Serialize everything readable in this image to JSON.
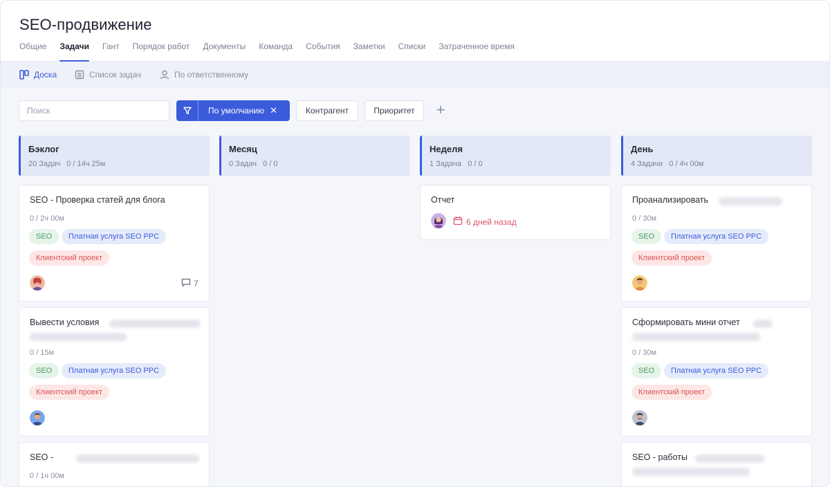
{
  "page_title": "SEO-продвижение",
  "tabs": [
    "Общие",
    "Задачи",
    "Гант",
    "Порядок работ",
    "Документы",
    "Команда",
    "События",
    "Заметки",
    "Списки",
    "Затраченное время"
  ],
  "active_tab": "Задачи",
  "views": {
    "board": "Доска",
    "list": "Список задач",
    "by_assignee": "По ответственному"
  },
  "toolbar": {
    "search_placeholder": "Поиск",
    "filter_label": "По умолчанию",
    "filter_clear": "✕",
    "counterparty": "Контрагент",
    "priority": "Приоритет",
    "add": "+"
  },
  "columns": [
    {
      "title": "Бэклог",
      "stats": "20 Задач   0 / 14ч 25м",
      "cards": [
        {
          "title": "SEO - Проверка статей для блога",
          "time": "0 / 2ч 00м",
          "tags": [
            "SEO",
            "Платная услуга SEO PPC",
            "Клиентский проект"
          ],
          "comments": "7"
        },
        {
          "title": "Вывести условия",
          "time": "0 / 15м",
          "tags": [
            "SEO",
            "Платная услуга SEO PPC",
            "Клиентский проект"
          ]
        },
        {
          "title": "SEO -",
          "time": "0 / 1ч 00м"
        }
      ]
    },
    {
      "title": "Месяц",
      "stats": "0 Задач   0 / 0",
      "cards": []
    },
    {
      "title": "Неделя",
      "stats": "1 Задача   0 / 0",
      "cards": [
        {
          "title": "Отчет",
          "due": "6 дней назад"
        }
      ]
    },
    {
      "title": "День",
      "stats": "4 Задачи   0 / 4ч 00м",
      "cards": [
        {
          "title": "Проанализировать",
          "time": "0 / 30м",
          "tags": [
            "SEO",
            "Платная услуга SEO PPC",
            "Клиентский проект"
          ]
        },
        {
          "title": "Сформировать мини отчет",
          "time": "0 / 30м",
          "tags": [
            "SEO",
            "Платная услуга SEO PPC",
            "Клиентский проект"
          ]
        },
        {
          "title": "SEO - работы"
        }
      ]
    }
  ],
  "colors": {
    "accent": "#3b5bdb",
    "column_header_bg": "#e3e8f7",
    "tag_seo": "#4a9b5e",
    "tag_paid": "#3b5bdb",
    "tag_client": "#d9534f",
    "overdue": "#e0566b"
  },
  "icons": [
    "board-icon",
    "list-icon",
    "person-icon",
    "filter-icon",
    "comment-icon",
    "calendar-icon",
    "plus-icon",
    "close-icon"
  ]
}
